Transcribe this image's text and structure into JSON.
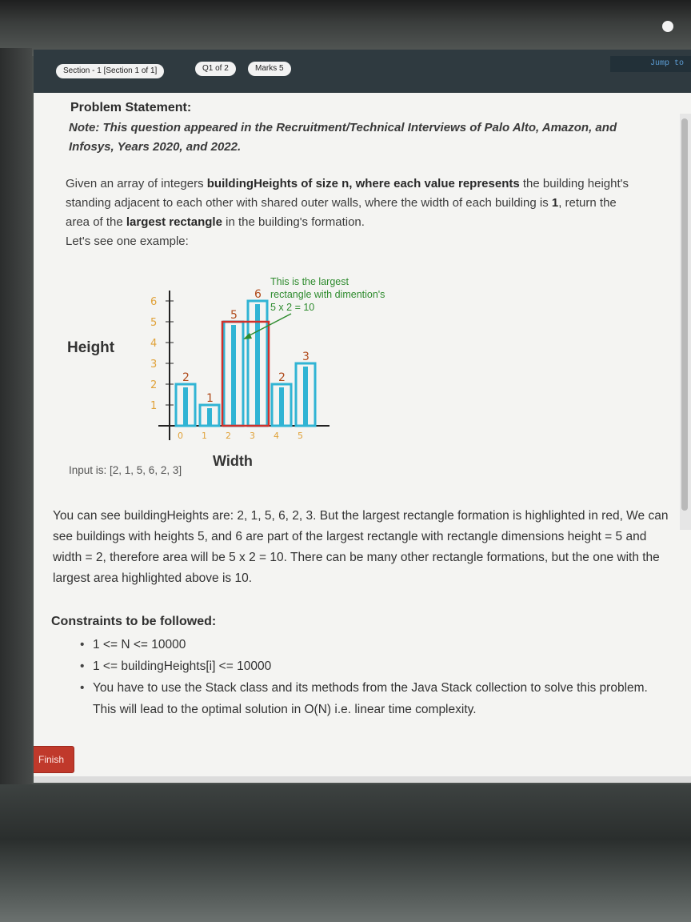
{
  "header": {
    "section": "Section - 1 [Section 1 of 1]",
    "question": "Q1 of 2",
    "marks": "Marks 5",
    "jump": "Jump to"
  },
  "problem": {
    "title": "Problem Statement:",
    "note": "Note: This question appeared in the Recruitment/Technical Interviews of Palo Alto, Amazon, and Infosys, Years 2020, and 2022.",
    "given_pre": "Given an array of integers ",
    "given_b1": "buildingHeights of size n, where each value represents",
    "given_mid": " the building height's standing adjacent to each other with shared outer walls, where the width of each building is ",
    "given_b2": "1",
    "given_mid2": ", return the area of the ",
    "given_b3": "largest rectangle",
    "given_post": " in the building's formation.",
    "example_intro": "Let's see one example:"
  },
  "figure": {
    "ylabel": "Height",
    "xlabel": "Width",
    "y_ticks": [
      "1",
      "2",
      "3",
      "4",
      "5",
      "6"
    ],
    "x_ticks": [
      "0",
      "1",
      "2",
      "3",
      "4",
      "5"
    ],
    "bar_labels": [
      "2",
      "1",
      "5",
      "6",
      "2",
      "3"
    ],
    "annotation_line1": "This is the largest",
    "annotation_line2": "rectangle with dimention's",
    "annotation_line3": "5 x 2 = 10",
    "input_text": "Input is: [2, 1, 5, 6, 2, 3]",
    "bar_color": "#31b4d4",
    "highlight_color": "#d0302b",
    "annotation_color": "#2e8b2e"
  },
  "chart_data": {
    "type": "bar",
    "categories": [
      "0",
      "1",
      "2",
      "3",
      "4",
      "5"
    ],
    "values": [
      2,
      1,
      5,
      6,
      2,
      3
    ],
    "xlabel": "Width",
    "ylabel": "Height",
    "ylim": [
      0,
      6
    ],
    "highlight": {
      "from_index": 2,
      "to_index": 3,
      "height": 5
    }
  },
  "explanation": "You can see buildingHeights are: 2, 1, 5, 6, 2, 3. But the largest rectangle formation is highlighted in red, We can see buildings with heights 5, and 6 are part of the largest rectangle with rectangle dimensions height = 5 and width = 2, therefore area will be 5 x 2 = 10. There can be many other rectangle formations, but the one with the largest area highlighted above is 10.",
  "constraints": {
    "title": "Constraints to be followed:",
    "items": [
      "1 <= N <= 10000",
      "1 <= buildingHeights[i] <= 10000",
      "You have to use the Stack class and its methods from the Java Stack collection to solve this problem. This will lead to the optimal solution in O(N) i.e. linear time complexity."
    ]
  },
  "footer": {
    "finish": "Finish"
  }
}
